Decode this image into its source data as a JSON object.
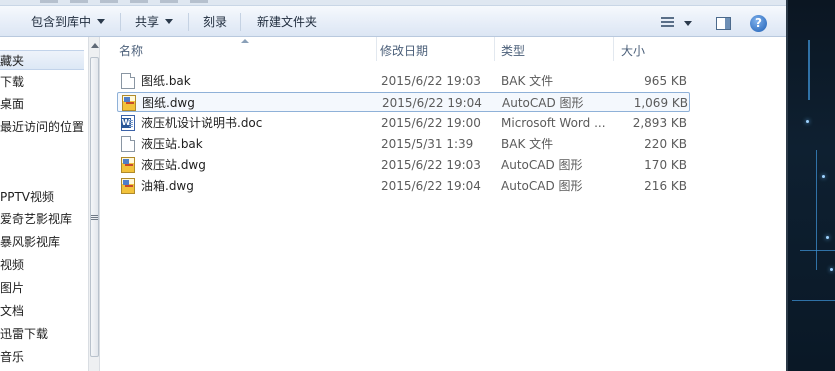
{
  "toolbar": {
    "include_library": "包含到库中",
    "share": "共享",
    "burn": "刻录",
    "new_folder": "新建文件夹",
    "help_glyph": "?"
  },
  "nav": {
    "items": [
      {
        "label": "藏夹"
      },
      {
        "label": "下载"
      },
      {
        "label": "桌面"
      },
      {
        "label": "最近访问的位置"
      },
      {
        "label": "PPTV视频"
      },
      {
        "label": "爱奇艺影视库"
      },
      {
        "label": "暴风影视库"
      },
      {
        "label": "视频"
      },
      {
        "label": "图片"
      },
      {
        "label": "文档"
      },
      {
        "label": "迅雷下载"
      },
      {
        "label": "音乐"
      }
    ]
  },
  "columns": {
    "name": "名称",
    "date": "修改日期",
    "type": "类型",
    "size": "大小"
  },
  "files": [
    {
      "name": "图纸.bak",
      "date": "2015/6/22 19:03",
      "type": "BAK 文件",
      "size": "965 KB",
      "icon": "file-icon"
    },
    {
      "name": "图纸.dwg",
      "date": "2015/6/22 19:04",
      "type": "AutoCAD 图形",
      "size": "1,069 KB",
      "icon": "autocad-icon"
    },
    {
      "name": "液压机设计说明书.doc",
      "date": "2015/6/22 19:00",
      "type": "Microsoft Word ...",
      "size": "2,893 KB",
      "icon": "word-icon"
    },
    {
      "name": "液压站.bak",
      "date": "2015/5/31 1:39",
      "type": "BAK 文件",
      "size": "220 KB",
      "icon": "file-icon"
    },
    {
      "name": "液压站.dwg",
      "date": "2015/6/22 19:03",
      "type": "AutoCAD 图形",
      "size": "170 KB",
      "icon": "autocad-icon"
    },
    {
      "name": "油箱.dwg",
      "date": "2015/6/22 19:04",
      "type": "AutoCAD 图形",
      "size": "216 KB",
      "icon": "autocad-icon"
    }
  ]
}
